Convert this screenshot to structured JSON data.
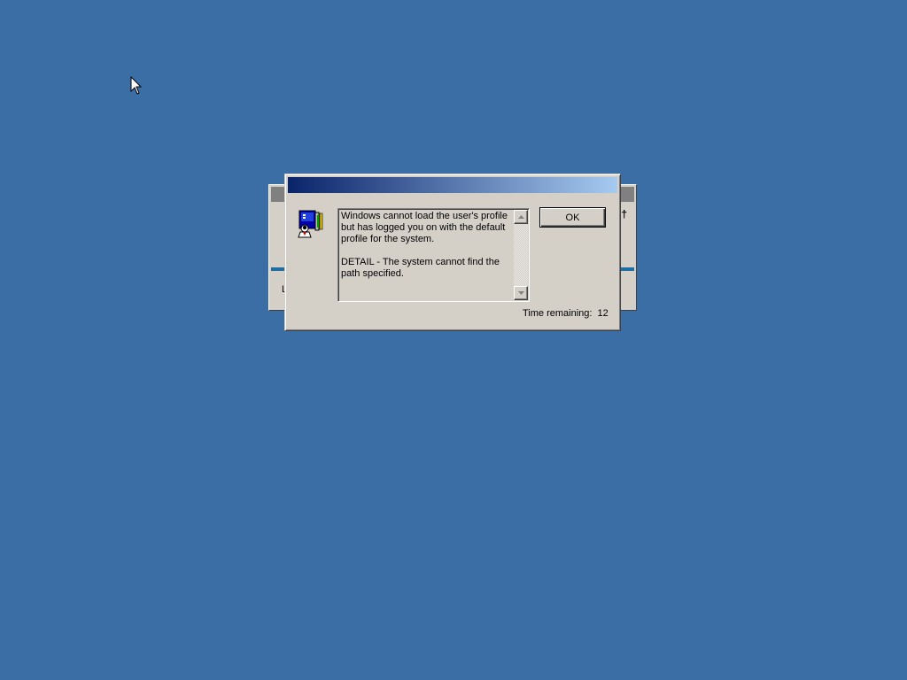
{
  "background_window": {
    "partial_label": "L",
    "title_color": "#808080",
    "band_color": "#1f6fa5"
  },
  "dialog": {
    "title": "",
    "icon": "user-profile-icon",
    "message": "Windows cannot load the user's profile but has logged you on with the default profile for the system.\n\nDETAIL - The system cannot find the path specified.",
    "ok_label": "OK",
    "time_remaining_label": "Time remaining:",
    "time_remaining_value": "12"
  },
  "colors": {
    "desktop": "#3a6ea5",
    "dialog_face": "#d4d0c8",
    "title_gradient_start": "#0a246a",
    "title_gradient_end": "#a6caf0"
  }
}
